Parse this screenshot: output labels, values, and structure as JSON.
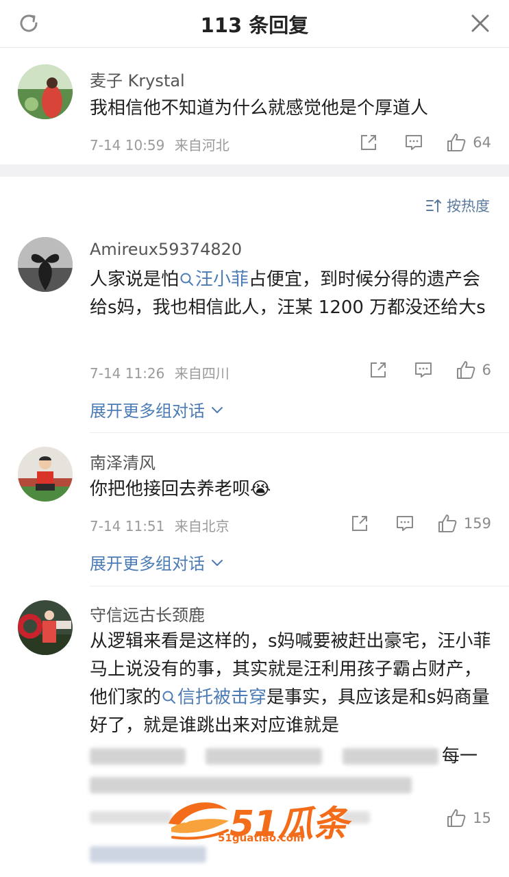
{
  "header": {
    "title": "113 条回复",
    "refresh_icon": "refresh-icon",
    "close_icon": "close-icon"
  },
  "top_comment": {
    "user": "麦子 Krystal",
    "text": "我相信他不知道为什么就感觉他是个厚道人",
    "time": "7-14 10:59",
    "location": "来自河北",
    "likes": "64"
  },
  "sort": {
    "label": "按热度",
    "icon": "sort-icon"
  },
  "comments": [
    {
      "user": "Amireux59374820",
      "text_before": "人家说是怕",
      "tag": "汪小菲",
      "text_after": "占便宜，到时候分得的遗产会给s妈，我也相信此人，汪某 1200 万都没还给大s",
      "time": "7-14 11:26",
      "location": "来自四川",
      "likes": "6",
      "expand": "展开更多组对话"
    },
    {
      "user": "南泽清风",
      "text": "你把他接回去养老呗",
      "emoji": "😭",
      "time": "7-14 11:51",
      "location": "来自北京",
      "likes": "159",
      "expand": "展开更多组对话"
    },
    {
      "user": "守信远古长颈鹿",
      "text_before": "从逻辑来看是这样的，s妈喊要被赶出豪宅，汪小菲马上说没有的事，其实就是汪利用孩子霸占财产，他们家的",
      "tag": "信托被击穿",
      "text_after": "是事实，具应该是和s妈商量好了，就是谁跳出来对应谁就是",
      "text_partial": "每一",
      "likes": "15"
    }
  ],
  "watermark": {
    "brand": "51瓜条",
    "url": "51guatiao.com"
  }
}
